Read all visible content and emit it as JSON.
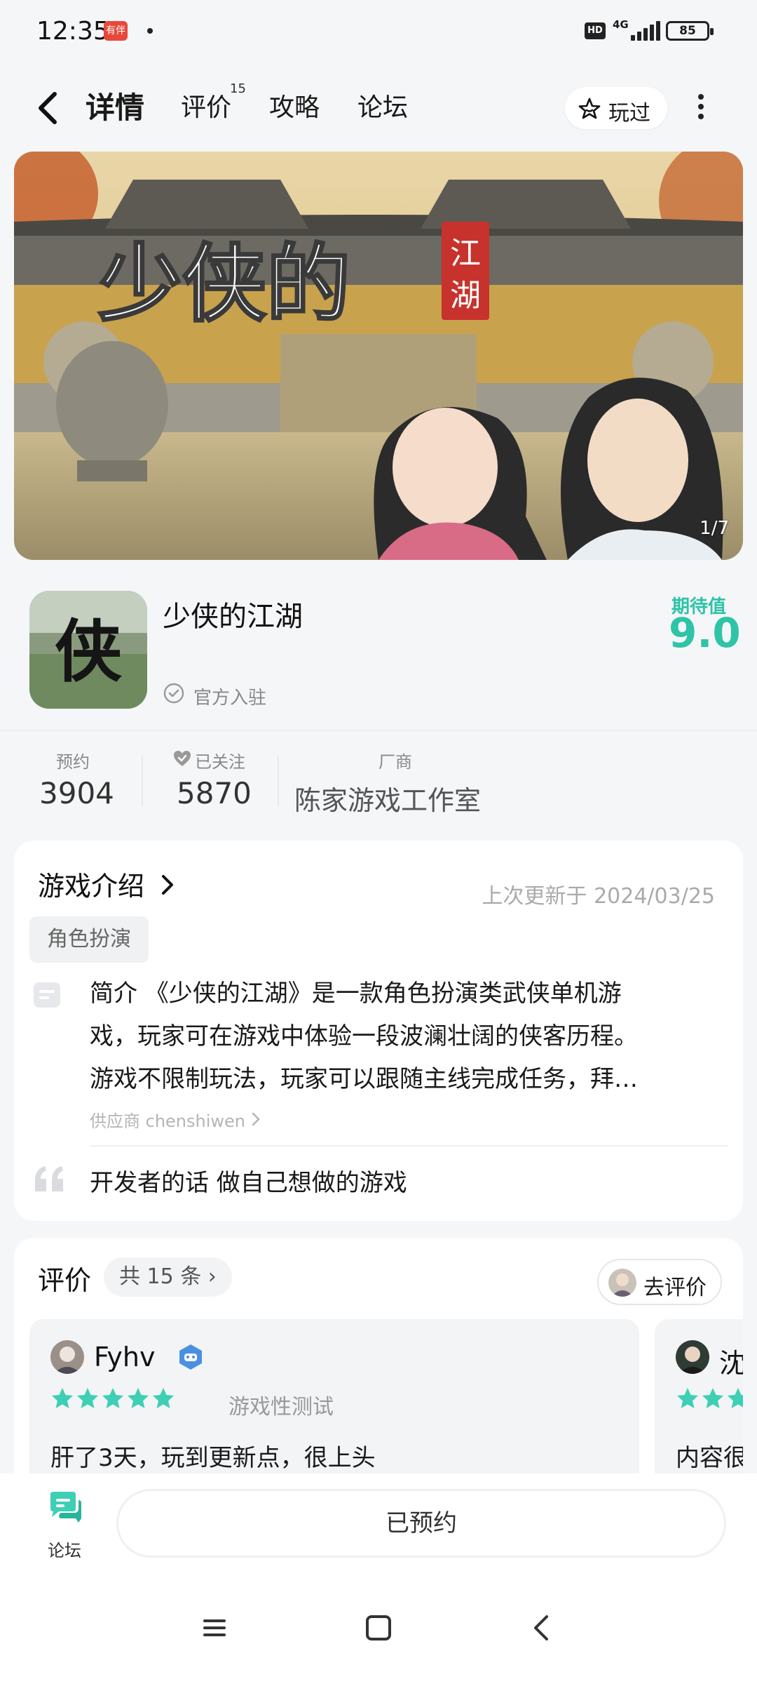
{
  "status_bar": {
    "time": "12:35",
    "app_badge": "有伴",
    "network": "4G",
    "hd": "HD",
    "battery": "85"
  },
  "nav": {
    "tabs": [
      {
        "label": "详情",
        "active": true
      },
      {
        "label": "评价",
        "badge": "15"
      },
      {
        "label": "攻略"
      },
      {
        "label": "论坛"
      }
    ],
    "played_label": "玩过"
  },
  "banner": {
    "calligraphy": "少侠的",
    "seal": "江湖",
    "counter": "1/7"
  },
  "game": {
    "icon_glyph": "侠",
    "title": "少侠的江湖",
    "official": "官方入驻",
    "expect_label": "期待值",
    "expect_score": "9.0"
  },
  "stats": [
    {
      "label": "预约",
      "value": "3904"
    },
    {
      "label": "已关注",
      "value": "5870"
    },
    {
      "label": "厂商",
      "value": "陈家游戏工作室"
    }
  ],
  "intro": {
    "title": "游戏介绍",
    "updated": "上次更新于 2024/03/25",
    "tag": "角色扮演",
    "description_lines": [
      "简介 《少侠的江湖》是一款角色扮演类武侠单机游",
      "戏，玩家可在游戏中体验一段波澜壮阔的侠客历程。",
      "游戏不限制玩法，玩家可以跟随主线完成任务，拜…"
    ],
    "provider": "供应商 chenshiwen",
    "developer_words": "开发者的话 做自己想做的游戏"
  },
  "reviews": {
    "title": "评价",
    "count": "共 15 条",
    "go_review": "去评价",
    "items": [
      {
        "name": "Fyhv",
        "tag": "游戏性测试",
        "content": "肝了3天，玩到更新点，很上头"
      },
      {
        "name": "沈",
        "content": "内容很"
      }
    ]
  },
  "bottom": {
    "forum_label": "论坛",
    "reserve_label": "已预约"
  },
  "colors": {
    "accent": "#2ec4a8",
    "background": "#f5f6f8"
  }
}
